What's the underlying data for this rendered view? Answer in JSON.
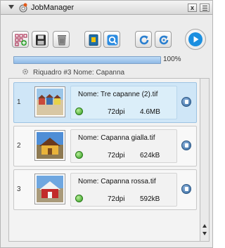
{
  "window": {
    "title": "JobManager"
  },
  "titlebar": {
    "close_label": "x"
  },
  "progress": {
    "percent": 100,
    "label": "100%"
  },
  "status": {
    "text": "Riquadro #3 Nome: Capanna"
  },
  "jobs": [
    {
      "index": "1",
      "name": "Nome: Tre capanne (2).tif",
      "dpi": "72dpi",
      "size": "4.6MB",
      "selected": true
    },
    {
      "index": "2",
      "name": "Nome: Capanna gialla.tif",
      "dpi": "72dpi",
      "size": "624kB",
      "selected": false
    },
    {
      "index": "3",
      "name": "Nome: Capanna rossa.tif",
      "dpi": "72dpi",
      "size": "592kB",
      "selected": false
    }
  ],
  "colors": {
    "accent": "#1b8fe0",
    "status_ok": "#2e9a1c",
    "selection": "#cfe6f7"
  },
  "icons": {
    "toolbar": [
      "grid-add-icon",
      "save-icon",
      "trash-icon",
      "book-icon",
      "search-icon",
      "refresh-icon",
      "refresh-alt-icon",
      "play-icon"
    ]
  }
}
